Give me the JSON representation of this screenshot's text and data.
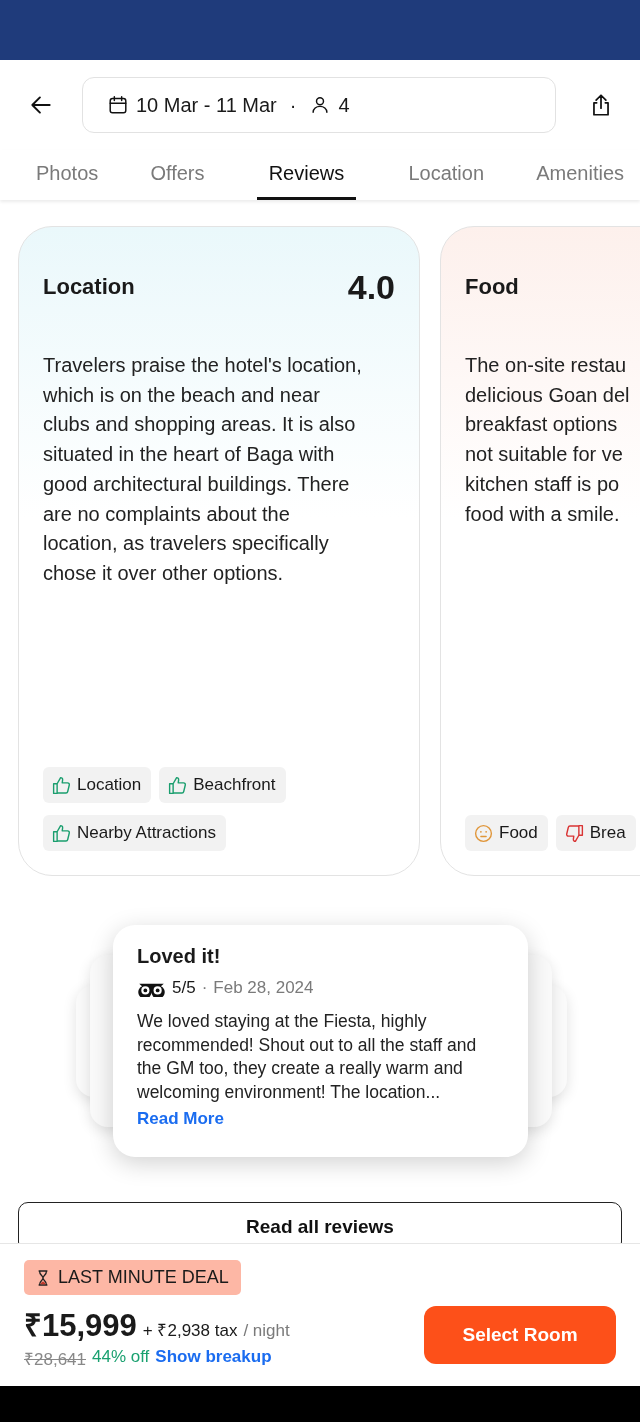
{
  "header": {
    "dates": "10 Mar - 11 Mar",
    "separator": "·",
    "guests": "4"
  },
  "tabs": [
    {
      "label": "Photos",
      "selected": false
    },
    {
      "label": "Offers",
      "selected": false
    },
    {
      "label": "Reviews",
      "selected": true
    },
    {
      "label": "Location",
      "selected": false
    },
    {
      "label": "Amenities",
      "selected": false
    }
  ],
  "summary_cards": [
    {
      "kind": "positive",
      "title": "Location",
      "score": "4.0",
      "lines": [
        "Travelers praise the hotel's location,",
        "which is on the beach and near",
        "clubs and shopping areas. It is also",
        "situated in the heart of Baga with",
        "good architectural buildings. There",
        "are no complaints about the",
        "location, as travelers specifically",
        "chose it over other options."
      ],
      "tags": [
        {
          "kind": "up",
          "label": "Location"
        },
        {
          "kind": "up",
          "label": "Beachfront"
        },
        {
          "kind": "up",
          "label": "Nearby Attractions"
        }
      ]
    },
    {
      "kind": "mixed",
      "title": "Food",
      "lines": [
        "The on-site restau",
        "delicious Goan del",
        "breakfast options",
        "not suitable for ve",
        "kitchen staff is po",
        "food with a smile."
      ],
      "tags": [
        {
          "kind": "neutral",
          "label": "Food"
        },
        {
          "kind": "down",
          "label": "Brea"
        }
      ]
    }
  ],
  "review": {
    "title": "Loved it!",
    "rating": "5/5",
    "separator": "·",
    "date": "Feb 28, 2024",
    "text": "We loved staying at the Fiesta, highly recommended! Shout out to all the staff and the GM too, they create a really warm and welcoming environment! The location...",
    "link": "Read More"
  },
  "all_reviews_button": "Read all reviews",
  "footer": {
    "badge": "LAST MINUTE DEAL",
    "price": "₹15,999",
    "tax": "+ ₹2,938 tax",
    "per": "/ night",
    "old_price": "₹28,641",
    "discount": "44% off",
    "breakup_link": "Show breakup",
    "button": "Select Room"
  }
}
